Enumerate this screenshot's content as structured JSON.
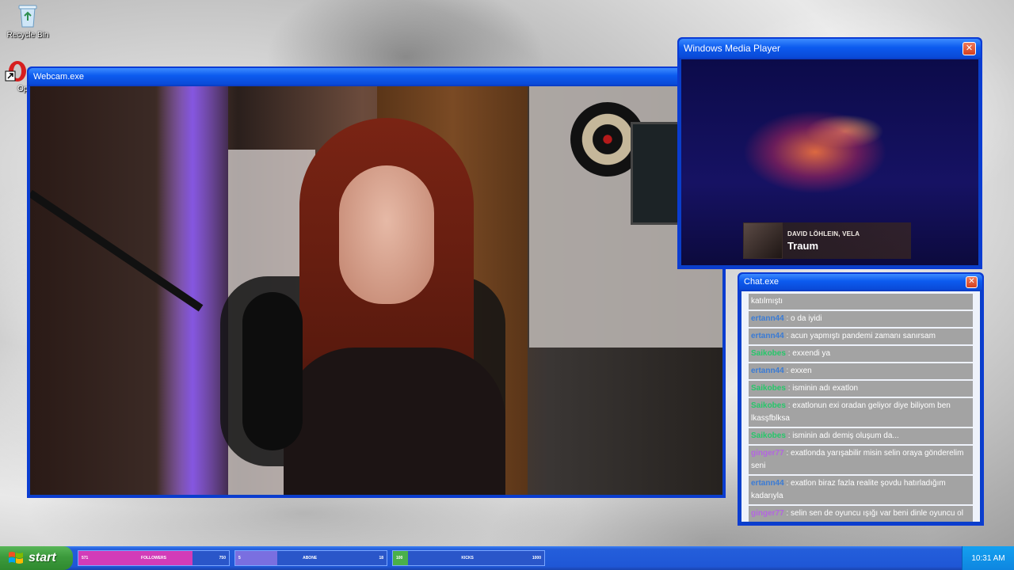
{
  "desktop": {
    "recycle_bin": "Recycle Bin",
    "second_icon_label": "Op"
  },
  "webcam": {
    "title": "Webcam.exe"
  },
  "media_player": {
    "title": "Windows Media Player",
    "now_playing": {
      "artist": "DAVID LÖHLEIN, VELA",
      "song": "Traum"
    }
  },
  "chat": {
    "title": "Chat.exe",
    "messages": [
      {
        "user": "",
        "color": "#ffffff",
        "text": "katılmıştı"
      },
      {
        "user": "ertann44",
        "color": "#3a7bd5",
        "text": "o da iyidi"
      },
      {
        "user": "ertann44",
        "color": "#3a7bd5",
        "text": "acun yapmıştı pandemi zamanı sanırsam"
      },
      {
        "user": "Saikobes",
        "color": "#26c76a",
        "text": "exxendi ya"
      },
      {
        "user": "ertann44",
        "color": "#3a7bd5",
        "text": "exxen"
      },
      {
        "user": "Saikobes",
        "color": "#26c76a",
        "text": "isminin adı exatlon"
      },
      {
        "user": "Saikobes",
        "color": "#26c76a",
        "text": "exatlonun exi oradan geliyor diye biliyom ben lkasşfblksa"
      },
      {
        "user": "Saikobes",
        "color": "#26c76a",
        "text": "isminin adı demiş oluşum da..."
      },
      {
        "user": "ginger77",
        "color": "#b366e0",
        "text": "exatlonda yarışabilir misin selin oraya gönderelim seni"
      },
      {
        "user": "ertann44",
        "color": "#3a7bd5",
        "text": "exatlon biraz fazla realite şovdu hatırladığım kadarıyla"
      },
      {
        "user": "ginger77",
        "color": "#b366e0",
        "text": "selin sen de oyuncu ışığı var beni dinle oyuncu ol"
      }
    ]
  },
  "taskbar": {
    "start_label": "start",
    "goals": [
      {
        "name": "FOLLOWERS",
        "current": "571",
        "target": "750",
        "progress": 0.76,
        "color": "#d23cb8"
      },
      {
        "name": "ABONE",
        "current": "5",
        "target": "18",
        "progress": 0.28,
        "color": "#7a6fe0"
      },
      {
        "name": "KICKS",
        "current": "100",
        "target": "1000",
        "progress": 0.1,
        "color": "#4ab04a"
      }
    ],
    "clock": "10:31 AM"
  }
}
